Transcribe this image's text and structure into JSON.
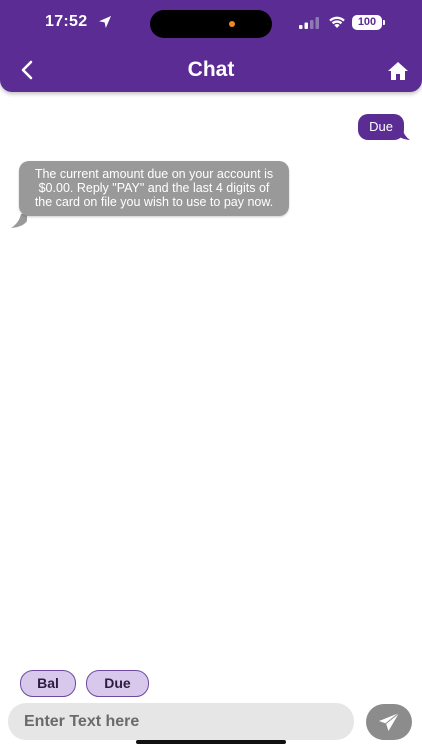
{
  "status_bar": {
    "time": "17:52",
    "battery": "100",
    "icons": [
      "location-arrow-icon",
      "cellular-signal-icon",
      "wifi-icon",
      "battery-icon"
    ]
  },
  "header": {
    "title": "Chat",
    "back_icon": "chevron-left-icon",
    "home_icon": "home-icon",
    "background_color": "#5b2c94"
  },
  "messages": [
    {
      "sender": "user",
      "text": "Due",
      "color": "#5b2c94"
    },
    {
      "sender": "bot",
      "text": "The current amount due on your account is $0.00. Reply \"PAY\" and the last 4 digits of the card on file you wish to use to pay now.",
      "color": "#999999"
    }
  ],
  "quick_replies": [
    {
      "label": "Bal"
    },
    {
      "label": "Due"
    }
  ],
  "composer": {
    "placeholder": "Enter Text here",
    "value": "",
    "send_icon": "send-icon"
  }
}
